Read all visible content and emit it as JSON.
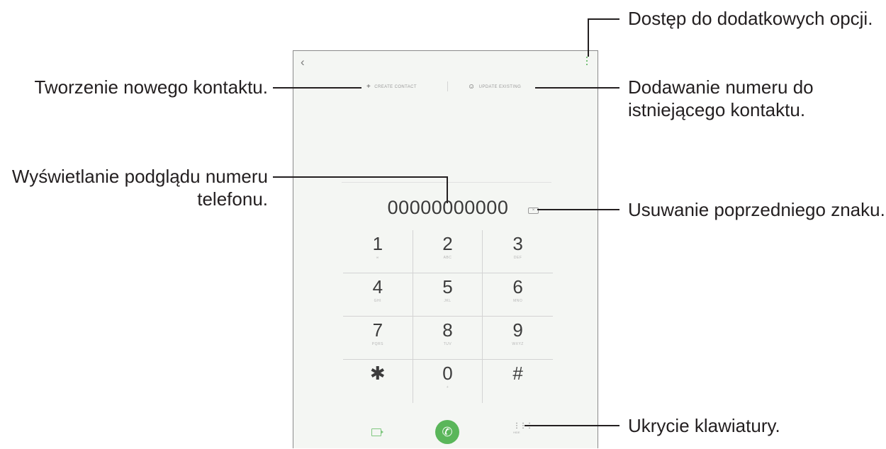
{
  "dialer": {
    "number": "00000000000",
    "create_contact_label": "CREATE CONTACT",
    "update_existing_label": "UPDATE EXISTING",
    "keys": [
      {
        "digit": "1",
        "sub": "∞"
      },
      {
        "digit": "2",
        "sub": "ABC"
      },
      {
        "digit": "3",
        "sub": "DEF"
      },
      {
        "digit": "4",
        "sub": "GHI"
      },
      {
        "digit": "5",
        "sub": "JKL"
      },
      {
        "digit": "6",
        "sub": "MNO"
      },
      {
        "digit": "7",
        "sub": "PQRS"
      },
      {
        "digit": "8",
        "sub": "TUV"
      },
      {
        "digit": "9",
        "sub": "WXYZ"
      },
      {
        "digit": "✱",
        "sub": ""
      },
      {
        "digit": "0",
        "sub": "+"
      },
      {
        "digit": "#",
        "sub": ""
      }
    ],
    "hide_label": "HIDE"
  },
  "icons": {
    "back": "back-arrow-icon",
    "more": "more-options-icon",
    "add": "plus-icon",
    "person": "person-icon",
    "backspace": "backspace-icon",
    "video": "video-call-icon",
    "call": "phone-icon",
    "keypad": "keypad-icon"
  },
  "colors": {
    "accent": "#5ab65a",
    "screen_bg": "#f4f6f3"
  },
  "callouts": {
    "more_options": "Dostęp do dodatkowych opcji.",
    "create_contact": "Tworzenie nowego kontaktu.",
    "add_to_existing_line1": "Dodawanie numeru do",
    "add_to_existing_line2": "istniejącego kontaktu.",
    "preview_line1": "Wyświetlanie podglądu numeru",
    "preview_line2": "telefonu.",
    "delete_char": "Usuwanie poprzedniego znaku.",
    "hide_keypad": "Ukrycie klawiatury."
  }
}
